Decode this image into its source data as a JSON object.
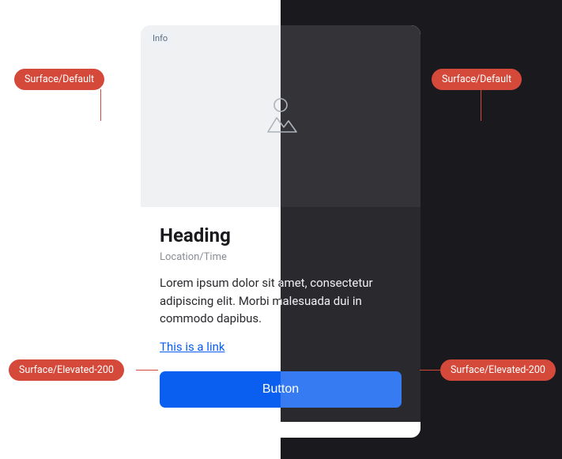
{
  "annotations": {
    "top_left": "Surface/Default",
    "top_right": "Surface/Default",
    "bottom_left": "Surface/Elevated-200",
    "bottom_right": "Surface/Elevated-200"
  },
  "card": {
    "badge": "Info",
    "heading": "Heading",
    "subheading": "Location/Time",
    "body": "Lorem ipsum dolor sit amet, consectetur adipiscing elit. Morbi malesuada dui in commodo dapibus.",
    "link": "This is a link",
    "button": "Button"
  }
}
